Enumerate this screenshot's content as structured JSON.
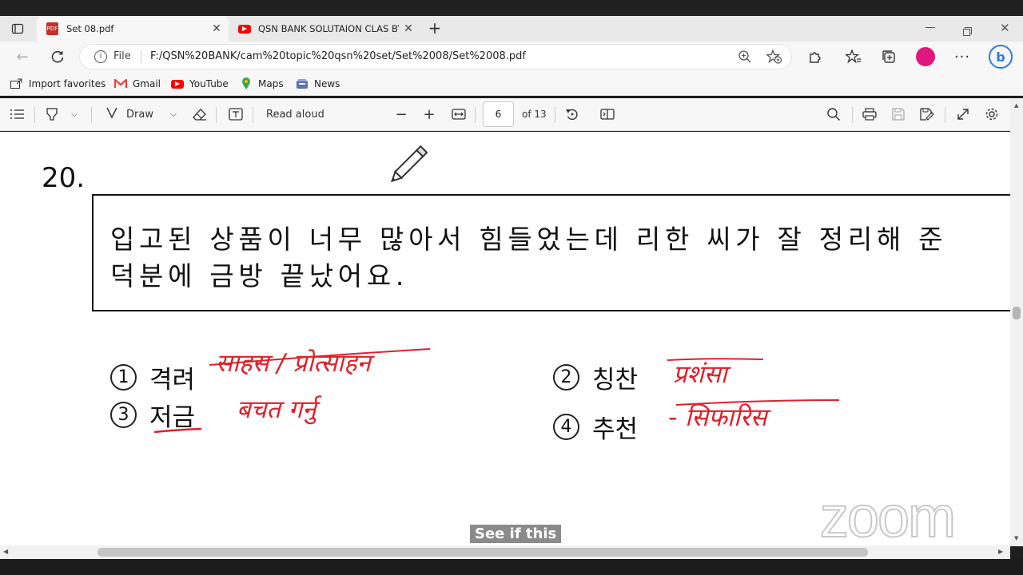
{
  "tabs": [
    {
      "title": "Set 08.pdf",
      "active": true
    },
    {
      "title": "QSN BANK SOLUTAION CLAS BY",
      "active": false
    }
  ],
  "address": {
    "label": "File",
    "url": "F:/QSN%20BANK/cam%20topic%20qsn%20set/Set%2008/Set%2008.pdf"
  },
  "favorites": [
    {
      "label": "Import favorites",
      "icon": "import-icon"
    },
    {
      "label": "Gmail",
      "icon": "gmail-icon"
    },
    {
      "label": "YouTube",
      "icon": "youtube-icon"
    },
    {
      "label": "Maps",
      "icon": "maps-icon"
    },
    {
      "label": "News",
      "icon": "news-icon"
    }
  ],
  "pdf_toolbar": {
    "draw_label": "Draw",
    "read_aloud_label": "Read aloud",
    "page_number": "6",
    "page_total": "of 13"
  },
  "question": {
    "number": "20.",
    "line1": "입고된 상품이 너무 많아서 힘들었는데 리한 씨가 잘 정리해 준",
    "line2": "덕분에 금방 끝났어요.",
    "options": [
      {
        "num": "1",
        "text": "격려",
        "note": "साहस / प्रोत्साहन"
      },
      {
        "num": "2",
        "text": "칭찬",
        "note": "प्रशंसा"
      },
      {
        "num": "3",
        "text": "저금",
        "note": "बचत गर्नु"
      },
      {
        "num": "4",
        "text": "추천",
        "note": "- सिफारिस"
      }
    ]
  },
  "caption": "See if this",
  "watermark": "zoom",
  "colors": {
    "annotation": "#e0202a",
    "caption_bg": "#8a8a8a",
    "profile": "#e0177f"
  }
}
